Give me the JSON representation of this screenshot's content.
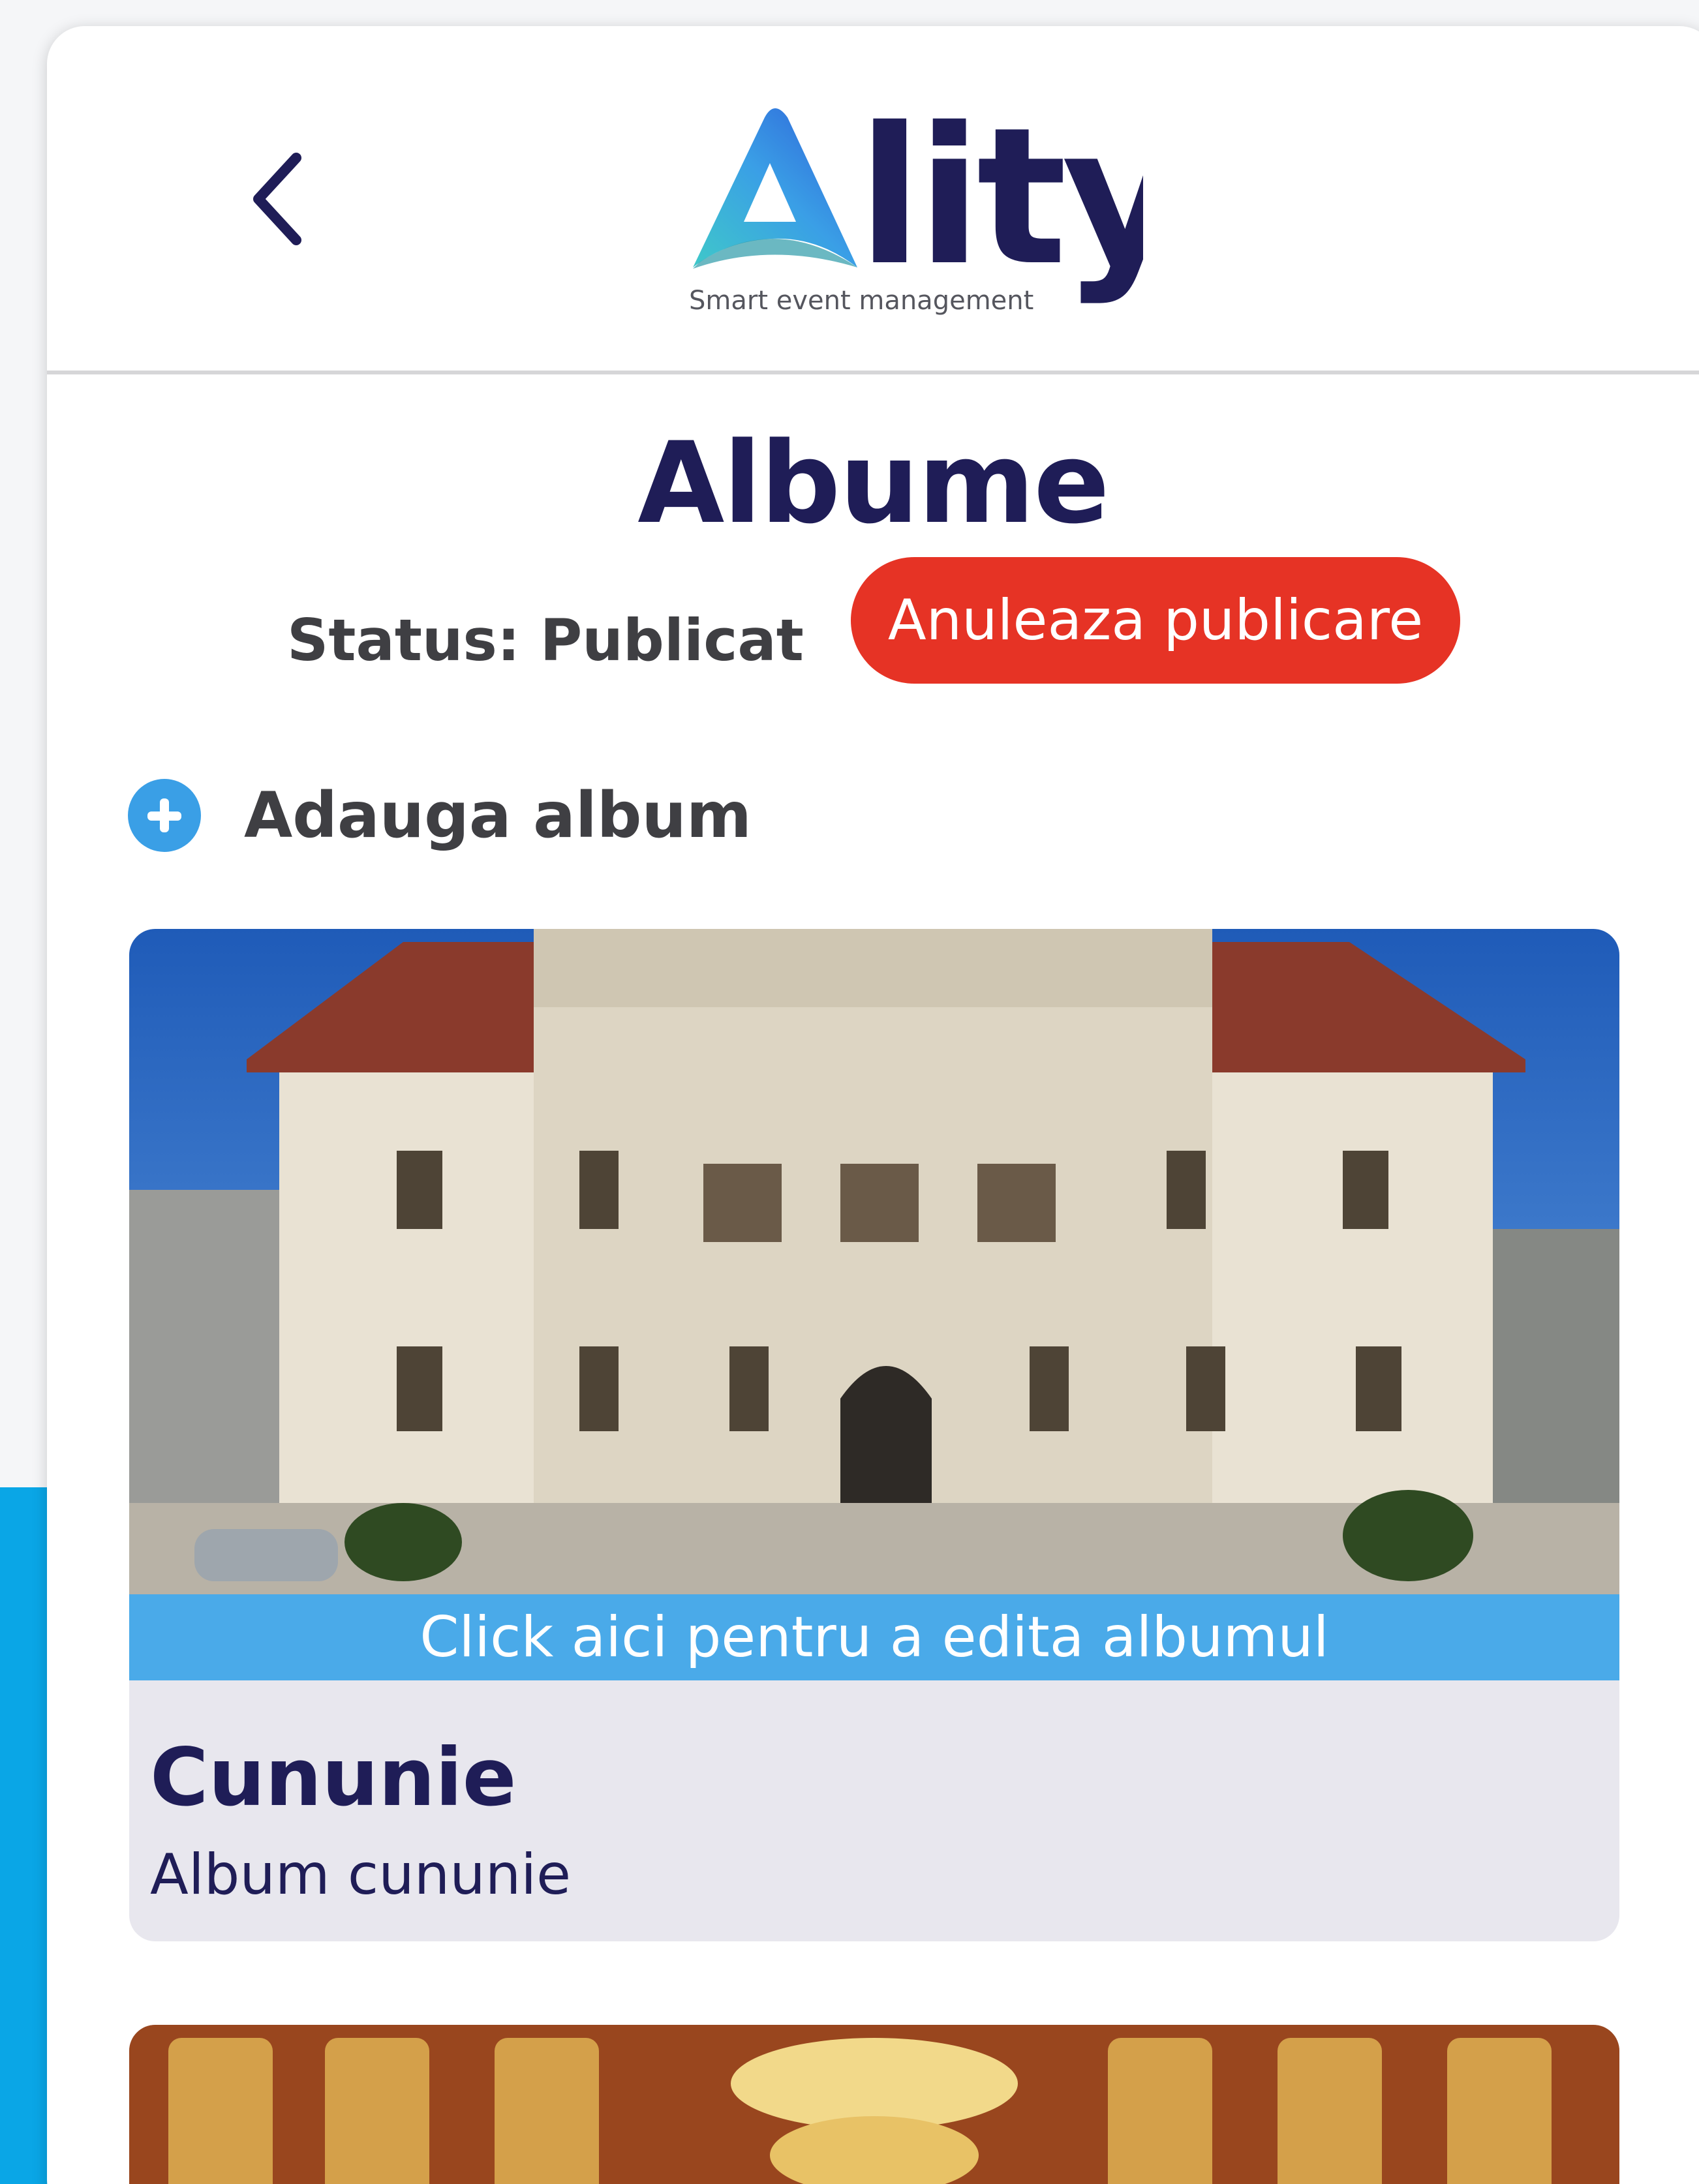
{
  "app": {
    "logo_text": "Ality",
    "logo_tagline": "Smart event management"
  },
  "colors": {
    "brand_navy": "#1f1d57",
    "accent_blue": "#3a9fe6",
    "danger_red": "#e63325"
  },
  "page": {
    "title": "Albume",
    "status_label": "Status: Publicat",
    "unpublish_button": "Anuleaza publicare",
    "add_album_label": "Adauga album"
  },
  "albums": [
    {
      "edit_hint": "Click aici pentru a edita albumul",
      "title": "Cununie",
      "description": "Album cununie"
    }
  ],
  "icons": {
    "back": "chevron-left-icon",
    "add": "plus-circle-icon"
  }
}
